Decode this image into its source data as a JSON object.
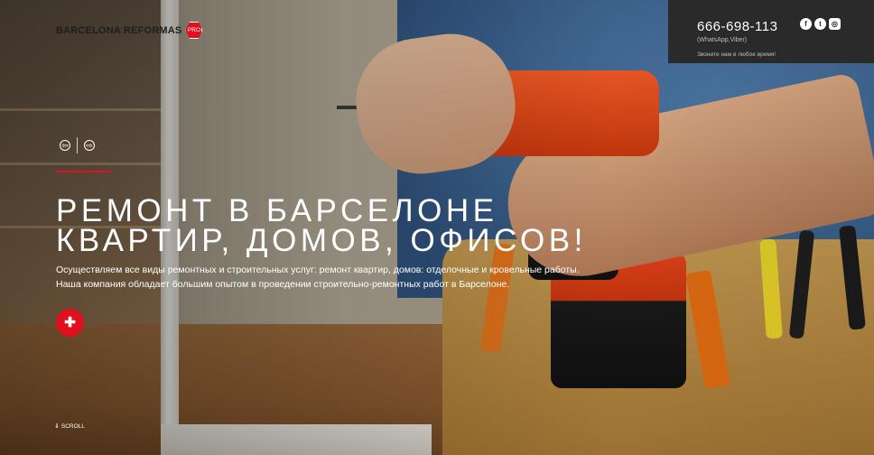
{
  "brand": {
    "name": "BARCELONA REFORMAS",
    "badge": "PRO"
  },
  "contact": {
    "phone": "666-698-113",
    "phone_note": "(WhatsApp,Viber)",
    "call_note": "Звоните нам в любое время!",
    "social": [
      {
        "icon": "facebook-icon",
        "glyph": "f"
      },
      {
        "icon": "twitter-icon",
        "glyph": "t"
      },
      {
        "icon": "instagram-icon",
        "glyph": "◎"
      }
    ]
  },
  "slider": {
    "prev_glyph": "⇦",
    "next_glyph": "⇨"
  },
  "hero": {
    "headline_line1": "РЕМОНТ В БАРСЕЛОНЕ",
    "headline_line2": "КВАРТИР, ДОМОВ, ОФИСОВ!",
    "desc_line1": "Осуществляем все виды ремонтных и строительных услуг: ремонт квартир, домов: отделочные и кровельные работы.",
    "desc_line2": "Наша компания обладает большим опытом в проведении строительно-ремонтных работ в Барселоне."
  },
  "plus_glyph": "✚",
  "scroll": {
    "label": "SCROLL",
    "glyph": "⇓"
  },
  "colors": {
    "accent": "#e1101e",
    "contact_bg": "#2a2a2a"
  }
}
